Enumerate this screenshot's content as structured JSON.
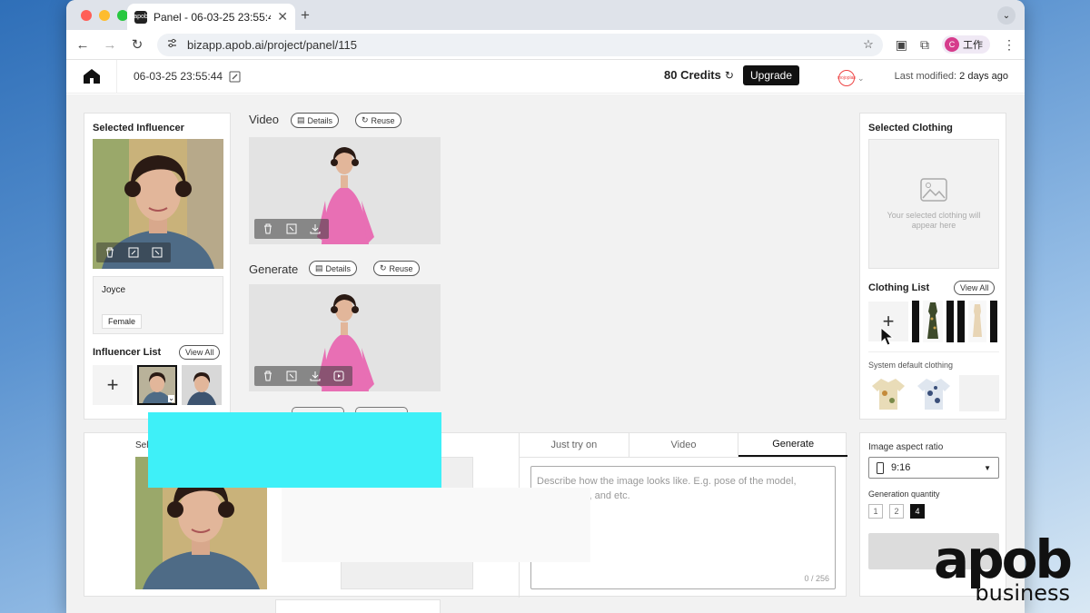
{
  "browser": {
    "tab_title": "Panel - 06-03-25 23:55:44",
    "url": "bizapp.apob.ai/project/panel/115",
    "profile_initial": "C",
    "profile_label": "工作",
    "favicon_text": "apob"
  },
  "header": {
    "project_name": "06-03-25 23:55:44",
    "credits": "80 Credits",
    "upgrade_label": "Upgrade",
    "brand_label": "mojoplan",
    "last_modified_label": "Last modified:",
    "last_modified_value": "2 days ago"
  },
  "influencer": {
    "title": "Selected Influencer",
    "name": "Joyce",
    "gender": "Female",
    "list_title": "Influencer List",
    "view_all": "View All"
  },
  "results": {
    "video_label": "Video",
    "generate_label": "Generate",
    "details_label": "Details",
    "reuse_label": "Reuse"
  },
  "clothing": {
    "title": "Selected Clothing",
    "placeholder": "Your selected clothing will appear here",
    "list_title": "Clothing List",
    "view_all": "View All",
    "system_default_title": "System default clothing"
  },
  "bottom": {
    "selected_label_partial": "Sel",
    "tabs": [
      "Just try on",
      "Video",
      "Generate"
    ],
    "active_tab": 2,
    "prompt_placeholder": "Describe how the image looks like. E.g. pose of the model, background, and etc.",
    "char_count": "0 / 256"
  },
  "settings": {
    "aspect_title": "Image aspect ratio",
    "aspect_value": "9:16",
    "quantity_title": "Generation quantity",
    "quantities": [
      "1",
      "2",
      "4"
    ],
    "active_quantity": 2
  },
  "watermark": {
    "big": "apob",
    "sub": "business"
  },
  "colors": {
    "accent": "#111111",
    "overlay_cyan": "#3ef0f8",
    "dress_pink": "#e86fb4"
  }
}
